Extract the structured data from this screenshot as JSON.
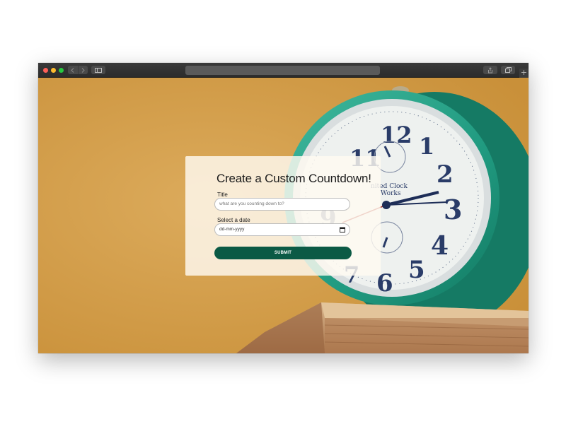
{
  "browser": {
    "url": "",
    "new_tab_label": "+"
  },
  "form": {
    "title": "Create a Custom Countdown!",
    "title_field": {
      "label": "Title",
      "placeholder": "what are you counting down to?"
    },
    "date_field": {
      "label": "Select a date",
      "value": "dd-mm-yyyy"
    },
    "submit_label": "SUBMIT"
  },
  "background": {
    "clock_brand_text": [
      "nited Clock",
      "Works"
    ],
    "numerals": [
      "12",
      "1",
      "2",
      "3",
      "4",
      "5",
      "6",
      "7",
      "9",
      "10",
      "11"
    ]
  },
  "colors": {
    "background_yellow": "#d6a350",
    "clock_green": "#2aa28a",
    "card_bg": "#fffaf1",
    "submit_bg": "#0b5a45",
    "traffic_red": "#fe5f57",
    "traffic_yellow": "#febc2e",
    "traffic_green": "#28c840"
  },
  "icons": {
    "back": "chevron-left-icon",
    "forward": "chevron-right-icon",
    "sidebar": "sidebar-icon",
    "share": "share-icon",
    "tabs": "tabs-icon",
    "calendar": "calendar-icon"
  }
}
